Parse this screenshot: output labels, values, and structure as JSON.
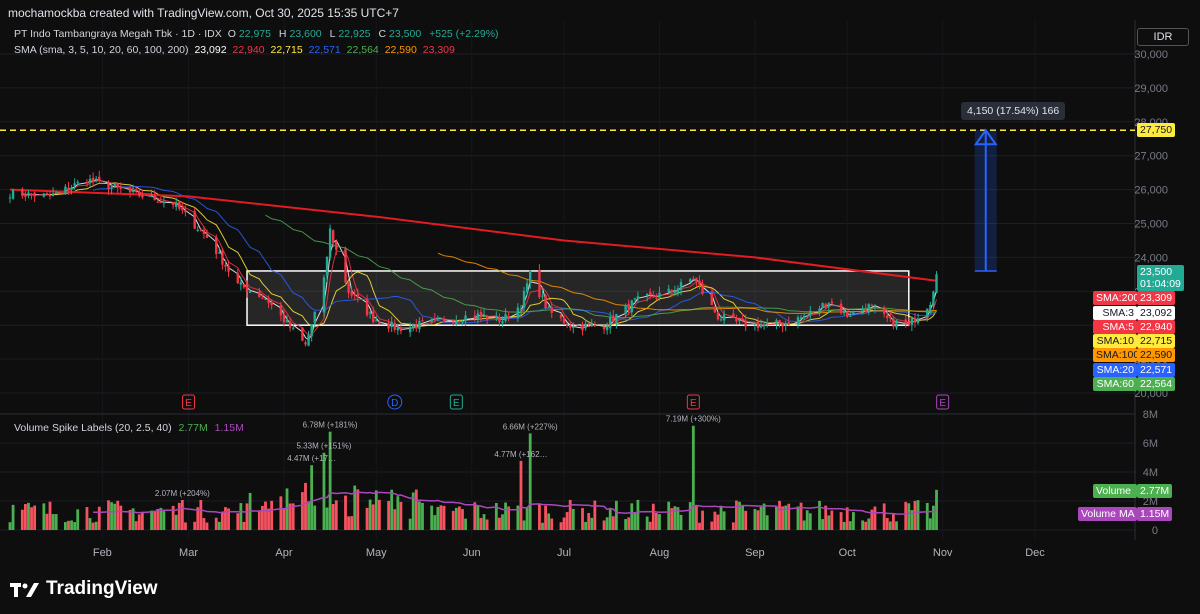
{
  "header": {
    "attribution": "mochamockba created with TradingView.com, Oct 30, 2025 15:35 UTC+7"
  },
  "legend": {
    "symbol": "PT Indo Tambangraya Megah Tbk · 1D · IDX",
    "ohlc": [
      {
        "k": "O",
        "v": "22,975"
      },
      {
        "k": "H",
        "v": "23,600"
      },
      {
        "k": "L",
        "v": "22,925"
      },
      {
        "k": "C",
        "v": "23,500"
      }
    ],
    "change": "+525 (+2.29%)",
    "sma_label": "SMA (sma, 3, 5, 10, 20, 60, 100, 200)",
    "sma_values": [
      {
        "v": "23,092",
        "color": "#ffffff"
      },
      {
        "v": "22,940",
        "color": "#f23645"
      },
      {
        "v": "22,715",
        "color": "#ffeb3b"
      },
      {
        "v": "22,571",
        "color": "#2962ff"
      },
      {
        "v": "22,564",
        "color": "#4caf50"
      },
      {
        "v": "22,590",
        "color": "#ff9800"
      },
      {
        "v": "23,309",
        "color": "#f23645"
      }
    ]
  },
  "currency": "IDR",
  "measure_label": "4,150 (17.54%) 166",
  "volume_legend": {
    "name": "Volume Spike Labels (20, 2.5, 40)",
    "v1": "2.77M",
    "v2": "1.15M"
  },
  "brand": "TradingView",
  "colors": {
    "up": "#22ab94",
    "down": "#f23645",
    "upVol": "#4caf50",
    "downVol": "#f7525f",
    "sma3": "#ffffff",
    "sma5": "#f23645",
    "sma10": "#ffeb3b",
    "sma20": "#2962ff",
    "sma60": "#4caf50",
    "sma100": "#ff9800",
    "sma200": "#e31b23",
    "volMA": "#ab47bc"
  },
  "chart_data": [
    {
      "type": "line",
      "pane": "price",
      "title": "PT Indo Tambangraya Megah Tbk · 1D · IDX",
      "y_ticks": [
        20000,
        21000,
        22000,
        23000,
        24000,
        25000,
        26000,
        27000,
        28000,
        29000,
        30000
      ],
      "y_tick_labels": [
        "20,000",
        "21,000",
        "22,000",
        "23,000",
        "24,000",
        "25,000",
        "26,000",
        "27,000",
        "28,000",
        "29,000",
        "30,000"
      ],
      "x_months": [
        "Feb",
        "Mar",
        "Apr",
        "May",
        "Jun",
        "Jul",
        "Aug",
        "Sep",
        "Oct",
        "Nov",
        "Dec"
      ],
      "x_month_dates": [
        "2025-02-01",
        "2025-03-01",
        "2025-04-01",
        "2025-05-01",
        "2025-06-01",
        "2025-07-01",
        "2025-08-01",
        "2025-09-01",
        "2025-10-01",
        "2025-11-01",
        "2025-12-01"
      ],
      "ylim": [
        19800,
        30300
      ],
      "close_series_dates": [
        "2025-01-02",
        "2025-01-15",
        "2025-01-27",
        "2025-02-10",
        "2025-02-24",
        "2025-03-07",
        "2025-03-17",
        "2025-03-26",
        "2025-04-08",
        "2025-04-14",
        "2025-04-16",
        "2025-04-22",
        "2025-04-30",
        "2025-05-08",
        "2025-05-20",
        "2025-06-02",
        "2025-06-11",
        "2025-06-17",
        "2025-06-20",
        "2025-06-26",
        "2025-07-04",
        "2025-07-14",
        "2025-07-24",
        "2025-08-05",
        "2025-08-12",
        "2025-08-20",
        "2025-08-27",
        "2025-09-04",
        "2025-09-11",
        "2025-09-18",
        "2025-09-25",
        "2025-10-01",
        "2025-10-08",
        "2025-10-15",
        "2025-10-21",
        "2025-10-28",
        "2025-10-30"
      ],
      "close_series": [
        25900,
        25800,
        26300,
        25900,
        25600,
        24600,
        23200,
        22800,
        21400,
        23300,
        24800,
        23000,
        22200,
        21900,
        22100,
        22300,
        22150,
        22600,
        23500,
        22400,
        21950,
        22000,
        22700,
        23000,
        23400,
        22250,
        22050,
        22000,
        22050,
        22300,
        22700,
        22300,
        22550,
        22100,
        22000,
        22700,
        23500
      ],
      "sma_series": [
        {
          "name": "SMA:3",
          "value": 23092,
          "label": "23,092"
        },
        {
          "name": "SMA:5",
          "value": 22940,
          "label": "22,940"
        },
        {
          "name": "SMA:10",
          "value": 22715,
          "label": "22,715"
        },
        {
          "name": "SMA:20",
          "value": 22571,
          "label": "22,571"
        },
        {
          "name": "SMA:60",
          "value": 22564,
          "label": "22,564"
        },
        {
          "name": "SMA:100",
          "value": 22590,
          "label": "22,590"
        },
        {
          "name": "SMA:200",
          "value": 23309,
          "label": "23,309"
        }
      ],
      "sma200_path": [
        [
          "2025-01-02",
          26000
        ],
        [
          "2025-03-01",
          25800
        ],
        [
          "2025-05-01",
          25200
        ],
        [
          "2025-07-01",
          24500
        ],
        [
          "2025-09-01",
          24000
        ],
        [
          "2025-10-30",
          23309
        ]
      ],
      "box": {
        "from": "2025-03-20",
        "to": "2025-10-21",
        "low": 22000,
        "high": 23600
      },
      "target_line": {
        "value": 27750,
        "label": "27,750"
      },
      "last_price": {
        "value": 23500,
        "label": "23,500",
        "countdown": "01:04:09"
      },
      "measure_arrow": {
        "date": "2025-11-15",
        "from": 23600,
        "to": 27750
      },
      "event_markers": [
        {
          "date": "2025-03-01",
          "label": "E"
        },
        {
          "date": "2025-05-07",
          "label": "D"
        },
        {
          "date": "2025-05-27",
          "label": "E"
        },
        {
          "date": "2025-08-12",
          "label": "E"
        },
        {
          "date": "2025-11-01",
          "label": "E"
        }
      ]
    },
    {
      "type": "bar",
      "pane": "volume",
      "title": "Volume Spike Labels (20, 2.5, 40)",
      "y_ticks": [
        0,
        2,
        4,
        6,
        8
      ],
      "y_tick_labels": [
        "0",
        "2M",
        "4M",
        "6M",
        "8M"
      ],
      "spike_labels": [
        {
          "date": "2025-02-27",
          "value": 2.07,
          "label": "2.07M (+204%)"
        },
        {
          "date": "2025-04-10",
          "value": 4.47,
          "label": "4.47M (+17…"
        },
        {
          "date": "2025-04-14",
          "value": 5.33,
          "label": "5.33M (+151%)"
        },
        {
          "date": "2025-04-16",
          "value": 6.78,
          "label": "6.78M (+181%)"
        },
        {
          "date": "2025-06-17",
          "value": 4.77,
          "label": "4.77M (+162…"
        },
        {
          "date": "2025-06-20",
          "value": 6.66,
          "label": "6.66M (+227%)"
        },
        {
          "date": "2025-08-12",
          "value": 7.19,
          "label": "7.19M (+300%)"
        }
      ],
      "last_volume": {
        "name": "Volume",
        "value": 2.77,
        "label": "2.77M"
      },
      "volume_ma": {
        "name": "Volume MA",
        "value": 1.15,
        "label": "1.15M"
      }
    }
  ]
}
